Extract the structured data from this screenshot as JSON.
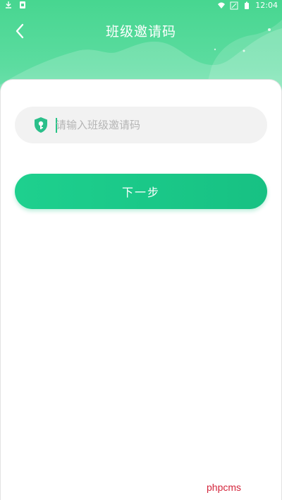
{
  "status_bar": {
    "time": "12:04",
    "icons": [
      "download-icon",
      "sim-icon",
      "wifi-icon",
      "signal-icon",
      "battery-icon"
    ]
  },
  "header": {
    "title": "班级邀请码",
    "back_icon": "chevron-left-icon",
    "gradient_top": "#47d690",
    "gradient_bottom": "#7fe4b8"
  },
  "invite": {
    "icon": "key-shield-icon",
    "placeholder": "请输入班级邀请码",
    "value": ""
  },
  "next_button": {
    "label": "下一步",
    "color": "#1ed08e"
  },
  "watermark": {
    "text": "phpcms",
    "color": "#d4263c"
  }
}
